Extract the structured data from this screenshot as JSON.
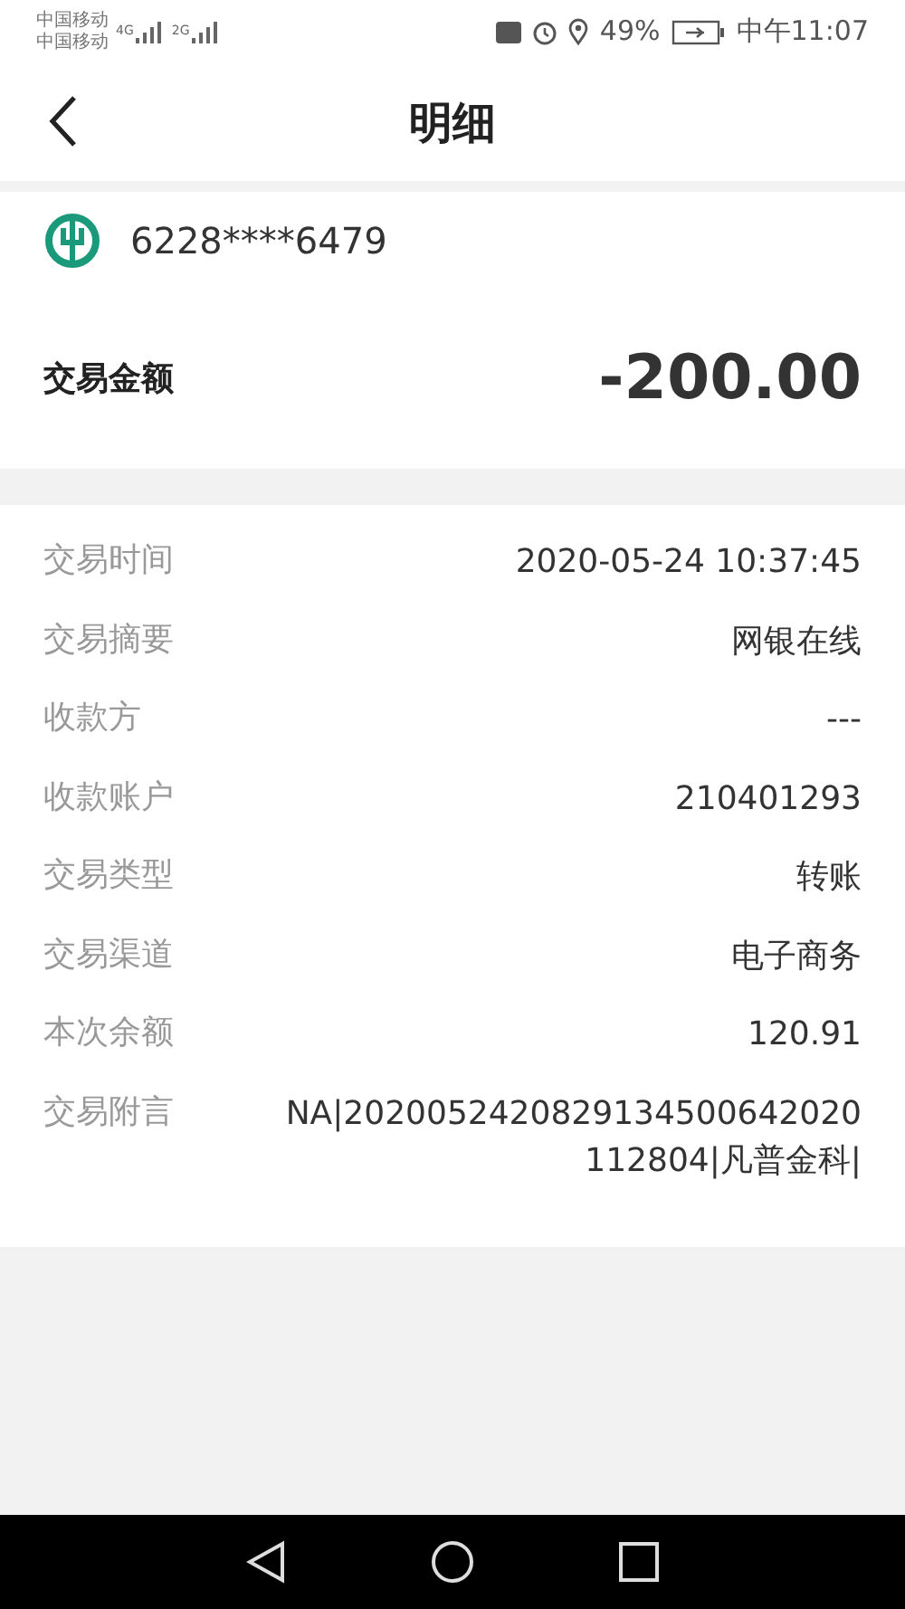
{
  "status_bar": {
    "carriers": [
      "中国移动",
      "中国移动"
    ],
    "network_labels": [
      "4G",
      "2G"
    ],
    "battery": "49%",
    "time": "中午11:07"
  },
  "header": {
    "title": "明细"
  },
  "account": {
    "number": "6228****6479"
  },
  "amount": {
    "label": "交易金额",
    "value": "-200.00"
  },
  "details": [
    {
      "label": "交易时间",
      "value": "2020-05-24 10:37:45"
    },
    {
      "label": "交易摘要",
      "value": "网银在线"
    },
    {
      "label": "收款方",
      "value": "---"
    },
    {
      "label": "收款账户",
      "value": "210401293"
    },
    {
      "label": "交易类型",
      "value": "转账"
    },
    {
      "label": "交易渠道",
      "value": "电子商务"
    },
    {
      "label": "本次余额",
      "value": "120.91"
    },
    {
      "label": "交易附言",
      "value": "NA|20200524208291345006420201​12804|凡普金科|"
    }
  ]
}
